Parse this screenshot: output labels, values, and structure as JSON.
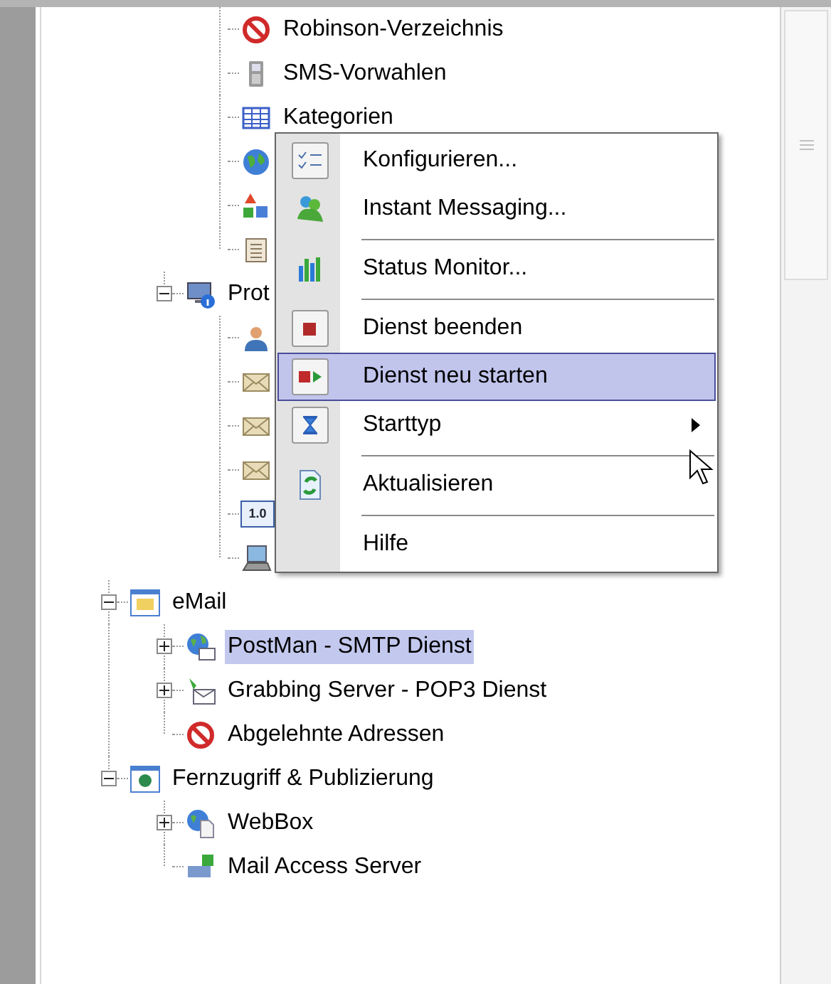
{
  "tree": [
    {
      "children": [
        {
          "children": [
            {
              "kind": "blocked",
              "label": "Robinson-Verzeichnis",
              "selected": false
            },
            {
              "kind": "phone",
              "label": "SMS-Vorwahlen",
              "selected": false
            },
            {
              "kind": "table",
              "label": "Kategorien",
              "selected": false
            },
            {
              "kind": "globe"
            },
            {
              "kind": "shapes"
            },
            {
              "kind": "list"
            }
          ]
        },
        {
          "kind": "monitor",
          "label": "Prot",
          "expanded": true,
          "selected": false,
          "children": [
            {
              "kind": "person"
            },
            {
              "kind": "envelope"
            },
            {
              "kind": "envelope"
            },
            {
              "kind": "envelope"
            },
            {
              "kind": "version",
              "badge": "1.0"
            },
            {
              "kind": "computer"
            }
          ]
        }
      ]
    },
    {
      "kind": "mailfolder",
      "label": "eMail",
      "expanded": true,
      "selected": false,
      "children": [
        {
          "kind": "globemail",
          "label": "PostMan -  SMTP Dienst",
          "expanded": false,
          "selected": true
        },
        {
          "kind": "grab",
          "label": "Grabbing Server -  POP3 Dienst",
          "expanded": false,
          "selected": false
        },
        {
          "kind": "blocked",
          "label": "Abgelehnte Adressen",
          "selected": false
        }
      ]
    },
    {
      "kind": "globefolder",
      "label": "Fernzugriff & Publizierung",
      "expanded": true,
      "selected": false,
      "children": [
        {
          "kind": "globedoc",
          "label": "WebBox",
          "expanded": false,
          "selected": false
        },
        {
          "kind": "server",
          "label": "Mail Access Server",
          "selected": false
        }
      ]
    }
  ],
  "context_menu": {
    "items": [
      {
        "kind": "checklist",
        "label": "Konfigurieren...",
        "selected": false
      },
      {
        "kind": "users",
        "label": "Instant Messaging...",
        "selected": false
      },
      {
        "kind": "separator"
      },
      {
        "kind": "chart",
        "label": "Status Monitor...",
        "selected": false
      },
      {
        "kind": "separator"
      },
      {
        "kind": "stop",
        "label": "Dienst beenden",
        "selected": false
      },
      {
        "kind": "restart",
        "label": "Dienst neu starten",
        "selected": true
      },
      {
        "kind": "hourglass",
        "label": "Starttyp",
        "selected": false,
        "submenu": true
      },
      {
        "kind": "separator"
      },
      {
        "kind": "refresh",
        "label": "Aktualisieren",
        "selected": false
      },
      {
        "kind": "separator"
      },
      {
        "kind": "plain",
        "label": "Hilfe",
        "selected": false
      }
    ]
  }
}
